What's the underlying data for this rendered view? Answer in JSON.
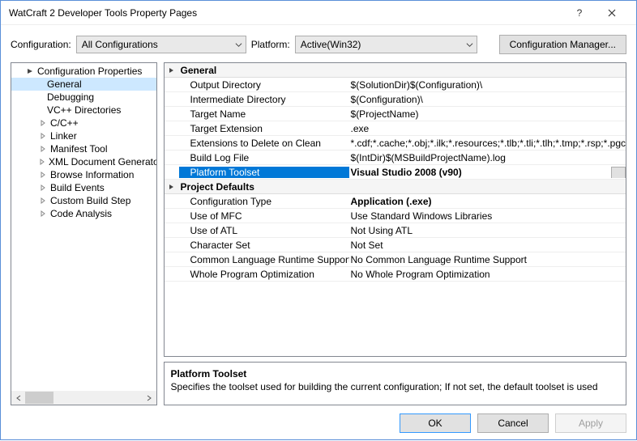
{
  "titlebar": {
    "title": "WatCraft 2 Developer Tools Property Pages"
  },
  "toolbar": {
    "config_label": "Configuration:",
    "config_value": "All Configurations",
    "platform_label": "Platform:",
    "platform_value": "Active(Win32)",
    "manager_btn": "Configuration Manager..."
  },
  "tree": {
    "root": "Configuration Properties",
    "items": [
      {
        "label": "General",
        "selected": true
      },
      {
        "label": "Debugging"
      },
      {
        "label": "VC++ Directories"
      },
      {
        "label": "C/C++",
        "expandable": true
      },
      {
        "label": "Linker",
        "expandable": true
      },
      {
        "label": "Manifest Tool",
        "expandable": true
      },
      {
        "label": "XML Document Generator",
        "expandable": true
      },
      {
        "label": "Browse Information",
        "expandable": true
      },
      {
        "label": "Build Events",
        "expandable": true
      },
      {
        "label": "Custom Build Step",
        "expandable": true
      },
      {
        "label": "Code Analysis",
        "expandable": true
      }
    ]
  },
  "grid": {
    "groups": [
      {
        "name": "General",
        "rows": [
          {
            "name": "Output Directory",
            "value": "$(SolutionDir)$(Configuration)\\"
          },
          {
            "name": "Intermediate Directory",
            "value": "$(Configuration)\\"
          },
          {
            "name": "Target Name",
            "value": "$(ProjectName)"
          },
          {
            "name": "Target Extension",
            "value": ".exe"
          },
          {
            "name": "Extensions to Delete on Clean",
            "value": "*.cdf;*.cache;*.obj;*.ilk;*.resources;*.tlb;*.tli;*.tlh;*.tmp;*.rsp;*.pgc"
          },
          {
            "name": "Build Log File",
            "value": "$(IntDir)$(MSBuildProjectName).log"
          },
          {
            "name": "Platform Toolset",
            "value": "Visual Studio 2008 (v90)",
            "selected": true
          }
        ]
      },
      {
        "name": "Project Defaults",
        "rows": [
          {
            "name": "Configuration Type",
            "value": "Application (.exe)",
            "bold": true
          },
          {
            "name": "Use of MFC",
            "value": "Use Standard Windows Libraries"
          },
          {
            "name": "Use of ATL",
            "value": "Not Using ATL"
          },
          {
            "name": "Character Set",
            "value": "Not Set"
          },
          {
            "name": "Common Language Runtime Support",
            "value": "No Common Language Runtime Support"
          },
          {
            "name": "Whole Program Optimization",
            "value": "No Whole Program Optimization"
          }
        ]
      }
    ]
  },
  "help": {
    "name": "Platform Toolset",
    "desc": "Specifies the toolset used for building the current configuration; If not set, the default toolset is used"
  },
  "footer": {
    "ok": "OK",
    "cancel": "Cancel",
    "apply": "Apply"
  }
}
